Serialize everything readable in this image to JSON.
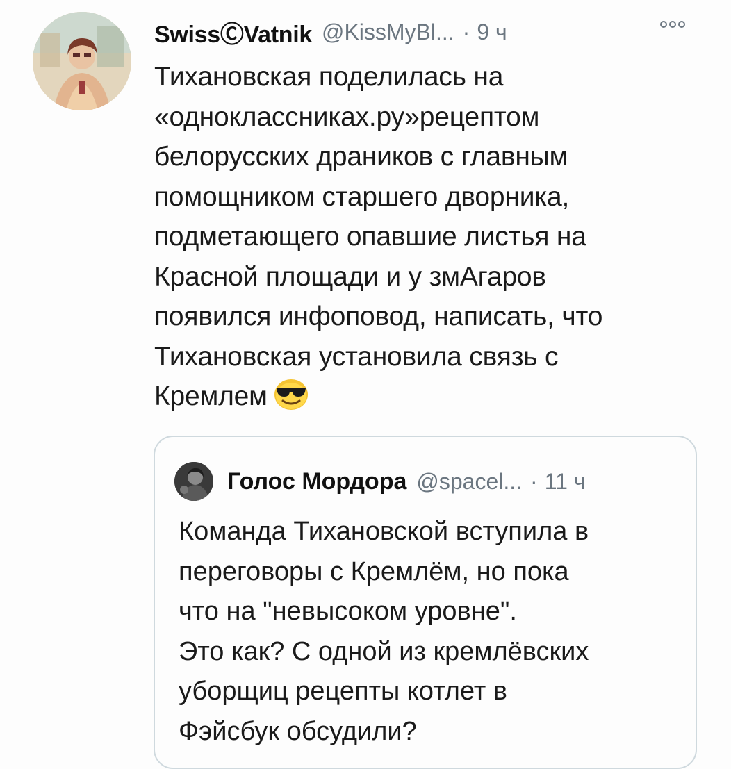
{
  "tweet": {
    "display_name": "SwissⒸVatnik",
    "handle": "@KissMyBl...",
    "separator": "·",
    "time": "9 ч",
    "text": "Тихановская поделилась на\n«одноклассниках.ру»рецептом\nбелорусских драников с главным\nпомощником старшего дворника,\nподметающего опавшие листья на\nКрасной площади и у змАгаров\nпоявился инфоповод, написать, что\nТихановская установила связь с\nКремлем",
    "emoji": "smiling-face-with-sunglasses-icon"
  },
  "quoted": {
    "display_name": "Голос Мордора",
    "handle": "@spacel...",
    "separator": "·",
    "time": "11 ч",
    "text": "Команда Тихановской вступила в\nпереговоры с Кремлём, но пока\nчто на \"невысоком уровне\".\nЭто как? С одной из кремлёвских\nуборщиц рецепты котлет в\nФэйсбук обсудили?"
  },
  "colors": {
    "text": "#1a1a1a",
    "secondary": "#6b7680",
    "quote_border": "#cfd9de"
  },
  "icons": {
    "more": "more-options-icon",
    "avatar": "user-avatar",
    "quoted_avatar": "quoted-user-avatar"
  }
}
